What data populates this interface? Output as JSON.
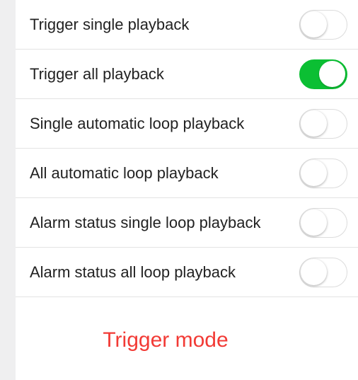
{
  "options": [
    {
      "label": "Trigger single playback",
      "enabled": false
    },
    {
      "label": "Trigger all playback",
      "enabled": true
    },
    {
      "label": "Single automatic loop playback",
      "enabled": false
    },
    {
      "label": "All automatic loop playback",
      "enabled": false
    },
    {
      "label": "Alarm status single loop playback",
      "enabled": false
    },
    {
      "label": "Alarm status all loop playback",
      "enabled": false
    }
  ],
  "title": "Trigger mode",
  "colors": {
    "toggle_on": "#0bbf33",
    "title": "#f23a35",
    "background": "#efeff0"
  }
}
